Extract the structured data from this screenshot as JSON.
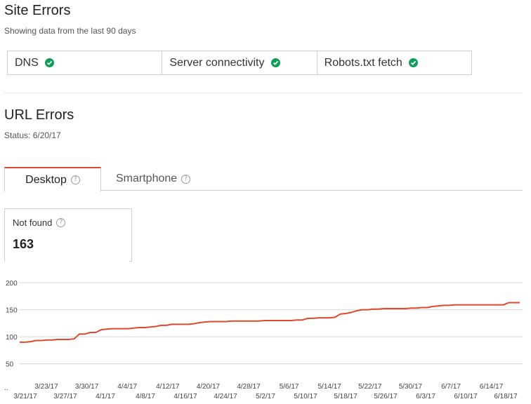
{
  "site_errors": {
    "title": "Site Errors",
    "subtitle": "Showing data from the last 90 days",
    "checks": [
      {
        "label": "DNS",
        "status_icon": "check-circle-icon"
      },
      {
        "label": "Server connectivity",
        "status_icon": "check-circle-icon"
      },
      {
        "label": "Robots.txt fetch",
        "status_icon": "check-circle-icon"
      }
    ],
    "status_color": "#0f9d58"
  },
  "url_errors": {
    "title": "URL Errors",
    "status": "Status: 6/20/17",
    "tabs": [
      {
        "label": "Desktop",
        "active": true
      },
      {
        "label": "Smartphone",
        "active": false
      }
    ],
    "help_glyph": "?",
    "metric": {
      "label": "Not found",
      "value": "163"
    }
  },
  "chart_data": {
    "type": "line",
    "title": "",
    "xlabel": "",
    "ylabel": "",
    "ylim": [
      25,
      200
    ],
    "yticks": [
      50,
      100,
      150,
      200
    ],
    "grid": true,
    "color": "#dd4b2c",
    "x_first_label": "..",
    "x_tick_labels_upper": [
      "3/23/17",
      "3/30/17",
      "4/4/17",
      "4/12/17",
      "4/20/17",
      "4/28/17",
      "5/6/17",
      "5/14/17",
      "5/22/17",
      "5/30/17",
      "6/7/17",
      "6/14/17"
    ],
    "x_tick_labels_lower": [
      "3/21/17",
      "3/27/17",
      "4/1/17",
      "4/8/17",
      "4/16/17",
      "4/24/17",
      "5/2/17",
      "5/10/17",
      "5/18/17",
      "5/26/17",
      "6/3/17",
      "6/10/17",
      "6/18/17"
    ],
    "series": [
      {
        "values": [
          90,
          90,
          91,
          93,
          93,
          94,
          94,
          95,
          95,
          95,
          96,
          105,
          105,
          108,
          108,
          113,
          114,
          115,
          115,
          115,
          115,
          116,
          117,
          117,
          118,
          119,
          121,
          121,
          123,
          123,
          123,
          123,
          124,
          126,
          127,
          128,
          128,
          128,
          128,
          129,
          129,
          129,
          129,
          129,
          129,
          130,
          130,
          130,
          130,
          130,
          130,
          131,
          131,
          134,
          134,
          135,
          135,
          135,
          136,
          142,
          143,
          145,
          148,
          150,
          150,
          151,
          151,
          152,
          152,
          152,
          152,
          152,
          153,
          153,
          154,
          154,
          156,
          157,
          158,
          158,
          159,
          159,
          159,
          159,
          159,
          159,
          159,
          159,
          159,
          159,
          163,
          163,
          163
        ]
      }
    ]
  }
}
